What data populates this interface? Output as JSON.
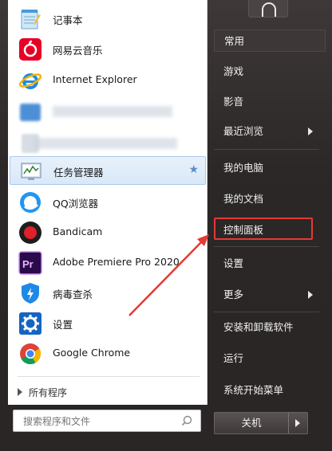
{
  "left_panel": {
    "programs": [
      {
        "label": "记事本",
        "icon": "notepad-icon"
      },
      {
        "label": "网易云音乐",
        "icon": "netease-music-icon"
      },
      {
        "label": "Internet Explorer",
        "icon": "internet-explorer-icon"
      },
      {
        "label": "",
        "icon": "blurred-app-icon"
      },
      {
        "label": "",
        "icon": "blurred-app-icon"
      },
      {
        "label": "任务管理器",
        "icon": "task-manager-icon",
        "pinned_star": "★"
      },
      {
        "label": "QQ浏览器",
        "icon": "qq-browser-icon"
      },
      {
        "label": "Bandicam",
        "icon": "bandicam-icon"
      },
      {
        "label": "Adobe Premiere Pro 2020",
        "icon": "premiere-pro-icon"
      },
      {
        "label": "病毒查杀",
        "icon": "antivirus-shield-icon"
      },
      {
        "label": "设置",
        "icon": "settings-gear-icon"
      },
      {
        "label": "Google Chrome",
        "icon": "chrome-icon"
      }
    ],
    "all_programs_label": "所有程序",
    "search_placeholder": "搜索程序和文件"
  },
  "right_panel": {
    "items": [
      {
        "label": "常用"
      },
      {
        "label": "游戏"
      },
      {
        "label": "影音"
      },
      {
        "label": "最近浏览"
      },
      {
        "label": "我的电脑"
      },
      {
        "label": "我的文档"
      },
      {
        "label": "控制面板"
      },
      {
        "label": "设置"
      },
      {
        "label": "更多"
      },
      {
        "label": "安装和卸载软件"
      },
      {
        "label": "运行"
      },
      {
        "label": "系统开始菜单"
      }
    ],
    "shutdown_label": "关机"
  },
  "colors": {
    "highlight_box": "#e53935",
    "annotation_arrow": "#e53935"
  }
}
